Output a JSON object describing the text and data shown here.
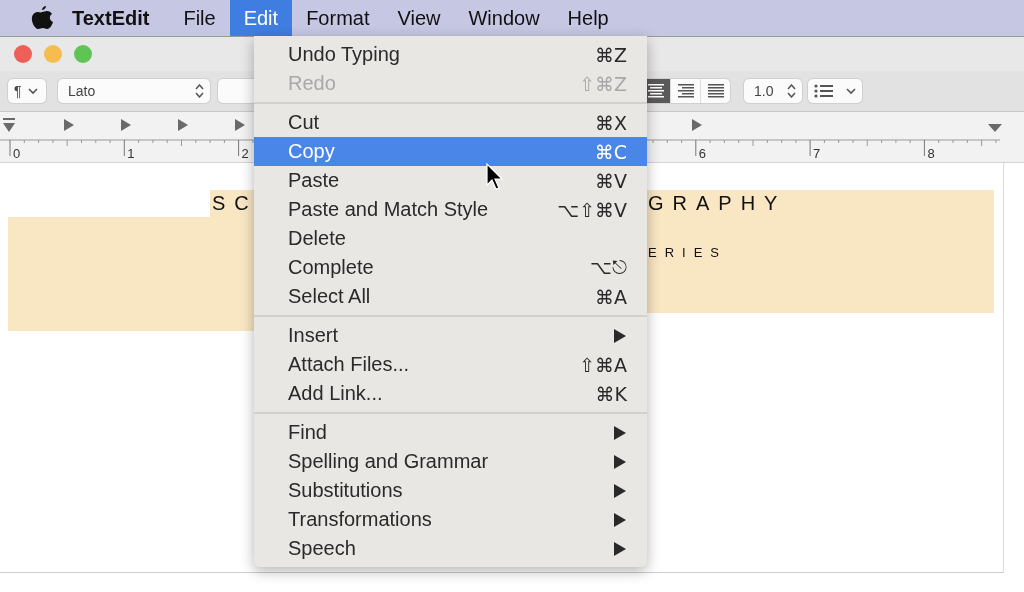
{
  "menu_bar": {
    "app_name": "TextEdit",
    "menus": [
      {
        "label": "File",
        "selected": false
      },
      {
        "label": "Edit",
        "selected": true
      },
      {
        "label": "Format",
        "selected": false
      },
      {
        "label": "View",
        "selected": false
      },
      {
        "label": "Window",
        "selected": false
      },
      {
        "label": "Help",
        "selected": false
      }
    ]
  },
  "toolbar": {
    "paragraph_style": "¶",
    "font": "Lato",
    "alignment": [
      {
        "kind": "center",
        "selected": true
      },
      {
        "kind": "right",
        "selected": false
      },
      {
        "kind": "justify",
        "selected": false
      }
    ],
    "line_spacing": "1.0"
  },
  "ruler": {
    "labels": [
      "0",
      "1",
      "2",
      "6",
      "7",
      "8"
    ]
  },
  "document": {
    "heading_left": "SC",
    "heading_right": "GRAPHY",
    "subheading": "ERIES"
  },
  "edit_menu": {
    "sections": [
      [
        {
          "label": "Undo Typing",
          "shortcut": "⌘Z",
          "kind": "command",
          "disabled": false,
          "selected": false
        },
        {
          "label": "Redo",
          "shortcut": "⇧⌘Z",
          "kind": "command",
          "disabled": true,
          "selected": false
        }
      ],
      [
        {
          "label": "Cut",
          "shortcut": "⌘X",
          "kind": "command",
          "disabled": false,
          "selected": false
        },
        {
          "label": "Copy",
          "shortcut": "⌘C",
          "kind": "command",
          "disabled": false,
          "selected": true
        },
        {
          "label": "Paste",
          "shortcut": "⌘V",
          "kind": "command",
          "disabled": false,
          "selected": false
        },
        {
          "label": "Paste and Match Style",
          "shortcut": "⌥⇧⌘V",
          "kind": "command",
          "disabled": false,
          "selected": false
        },
        {
          "label": "Delete",
          "kind": "command",
          "disabled": false,
          "selected": false
        },
        {
          "label": "Complete",
          "shortcut": "⌥⎋",
          "kind": "command",
          "disabled": false,
          "selected": false
        },
        {
          "label": "Select All",
          "shortcut": "⌘A",
          "kind": "command",
          "disabled": false,
          "selected": false
        }
      ],
      [
        {
          "label": "Insert",
          "kind": "submenu",
          "disabled": false,
          "selected": false
        },
        {
          "label": "Attach Files...",
          "shortcut": "⇧⌘A",
          "kind": "command",
          "disabled": false,
          "selected": false
        },
        {
          "label": "Add Link...",
          "shortcut": "⌘K",
          "kind": "command",
          "disabled": false,
          "selected": false
        }
      ],
      [
        {
          "label": "Find",
          "kind": "submenu",
          "disabled": false,
          "selected": false
        },
        {
          "label": "Spelling and Grammar",
          "kind": "submenu",
          "disabled": false,
          "selected": false
        },
        {
          "label": "Substitutions",
          "kind": "submenu",
          "disabled": false,
          "selected": false
        },
        {
          "label": "Transformations",
          "kind": "submenu",
          "disabled": false,
          "selected": false
        },
        {
          "label": "Speech",
          "kind": "submenu",
          "disabled": false,
          "selected": false
        }
      ]
    ]
  }
}
